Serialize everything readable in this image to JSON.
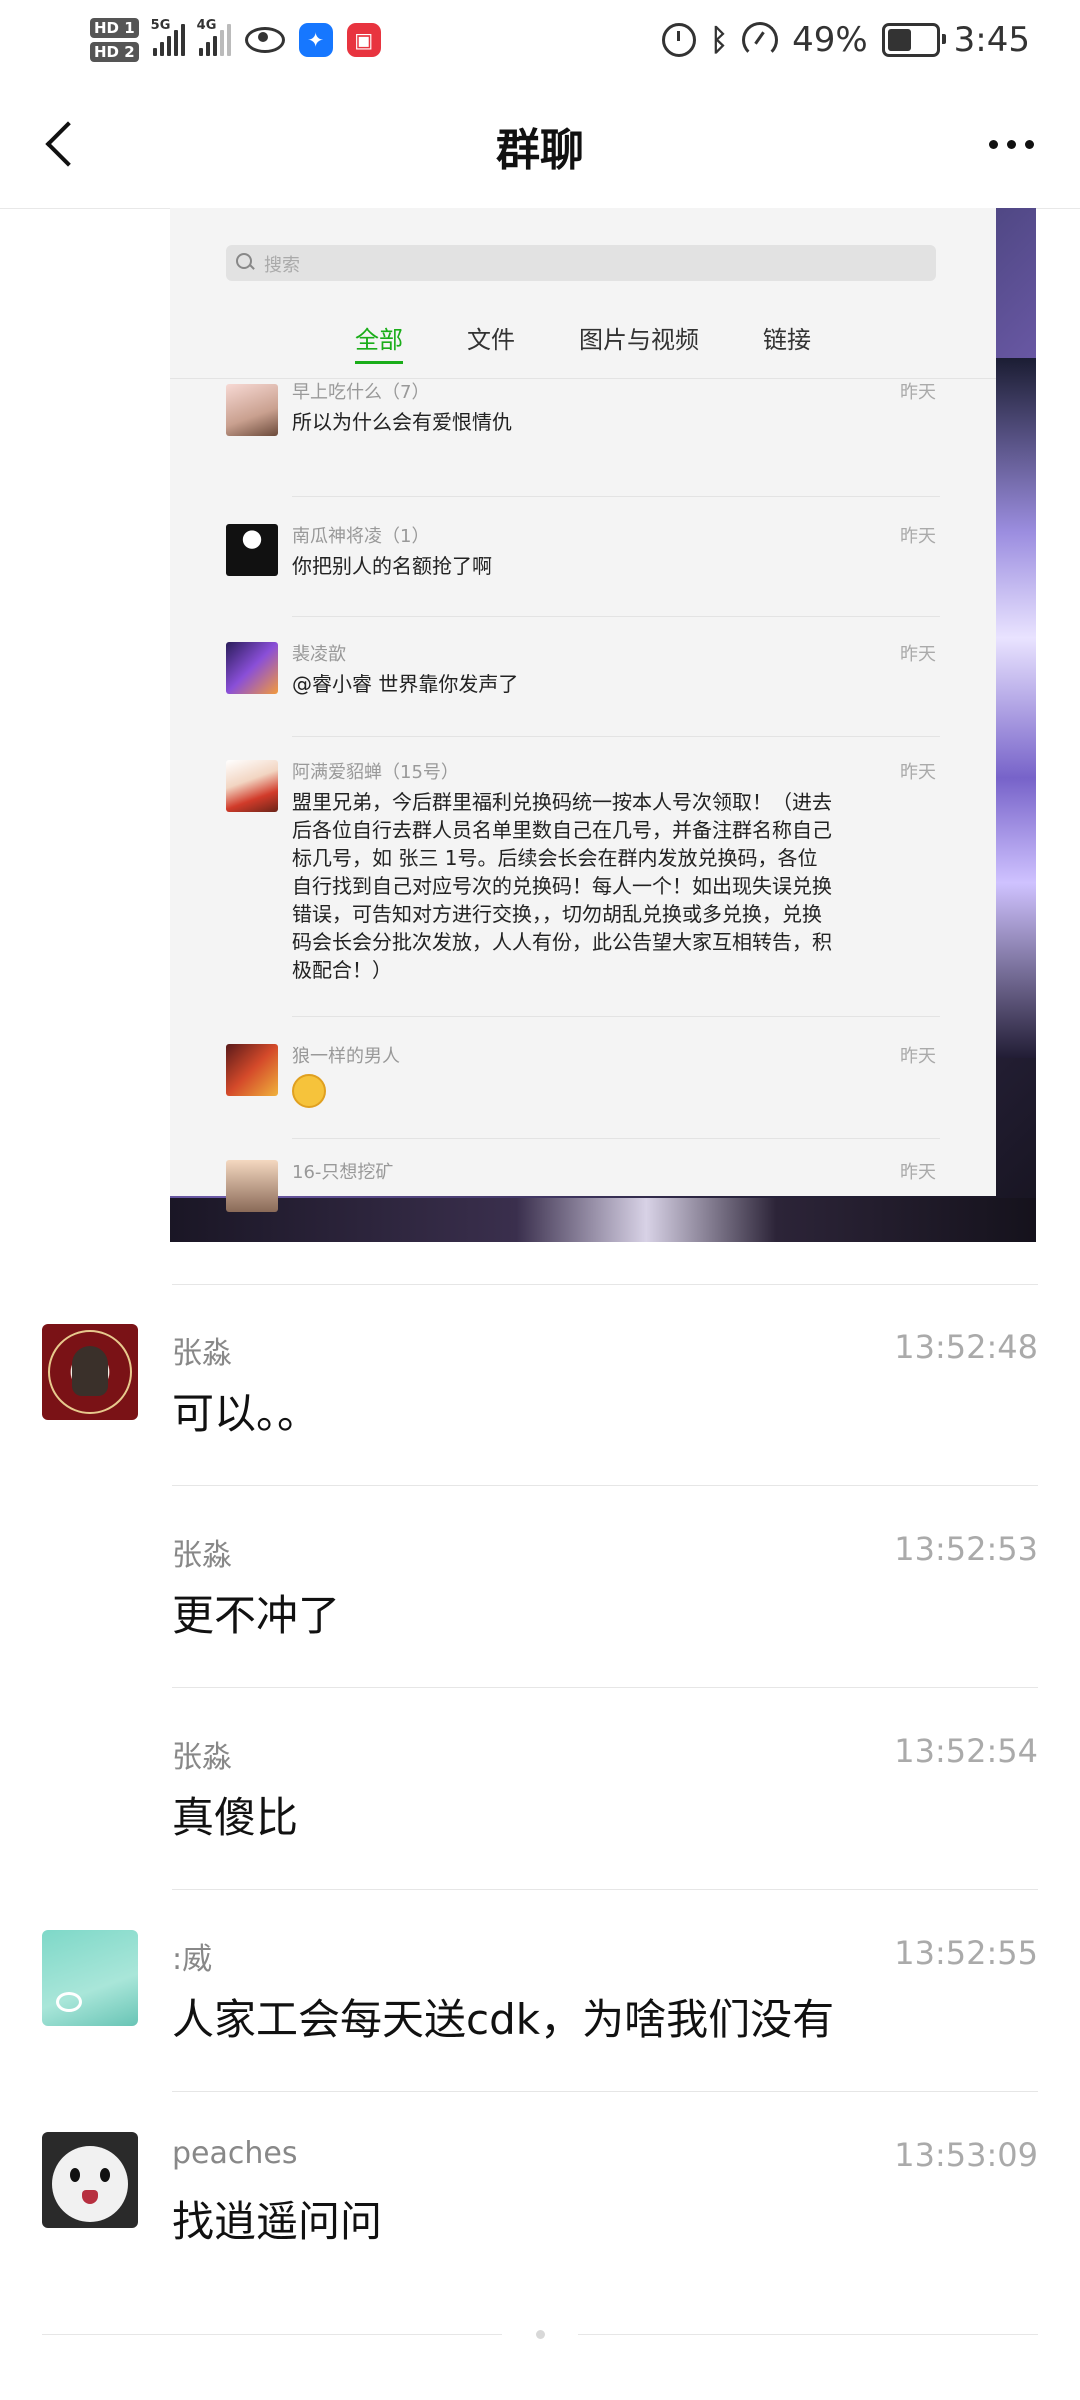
{
  "status_bar": {
    "sim1": "HD 1",
    "sim2": "HD 2",
    "net1": "5G",
    "net2": "4G",
    "battery": "49%",
    "battery_level": 0.49,
    "time": "3:45",
    "icons": [
      "eye-icon",
      "app-bulb-icon",
      "app-book-icon",
      "alarm-icon",
      "bluetooth-icon",
      "gauge-icon",
      "battery-icon"
    ]
  },
  "header": {
    "title": "群聊"
  },
  "shared_image": {
    "search_placeholder": "搜索",
    "tabs": [
      "全部",
      "文件",
      "图片与视频",
      "链接"
    ],
    "active_tab": "全部",
    "items": [
      {
        "name": "早上吃什么（7）",
        "time": "昨天",
        "text": "所以为什么会有爱恨情仇"
      },
      {
        "name": "南瓜神将凌（1）",
        "time": "昨天",
        "text": "你把别人的名额抢了啊"
      },
      {
        "name": "裴凌歆",
        "time": "昨天",
        "text": "@睿小睿 世界靠你发声了"
      },
      {
        "name": "阿满爱貂蝉（15号）",
        "time": "昨天",
        "text": "盟里兄弟，今后群里福利兑换码统一按本人号次领取！（进去后各位自行去群人员名单里数自己在几号，并备注群名称自己标几号，如 张三 1号。后续会长会在群内发放兑换码，各位自行找到自己对应号次的兑换码！每人一个！如出现失误兑换错误，可告知对方进行交换，，切勿胡乱兑换或多兑换，兑换码会长会分批次发放，人人有份，此公告望大家互相转告，积极配合！）"
      },
      {
        "name": "狼一样的男人",
        "time": "昨天",
        "text": ""
      },
      {
        "name": "16-只想挖矿",
        "time": "昨天",
        "text": ""
      }
    ]
  },
  "messages": [
    {
      "sender": "张淼",
      "time": "13:52:48",
      "text": "可以。。",
      "avatar": "pku-avatar"
    },
    {
      "sender": "张淼",
      "time": "13:52:53",
      "text": "更不冲了",
      "avatar": ""
    },
    {
      "sender": "张淼",
      "time": "13:52:54",
      "text": "真傻比",
      "avatar": ""
    },
    {
      "sender": ":威",
      "time": "13:52:55",
      "text": "人家工会每天送cdk，为啥我们没有",
      "avatar": "teal-avatar"
    },
    {
      "sender": "peaches",
      "time": "13:53:09",
      "text": "找逍遥问问",
      "avatar": "bunny-avatar"
    }
  ]
}
